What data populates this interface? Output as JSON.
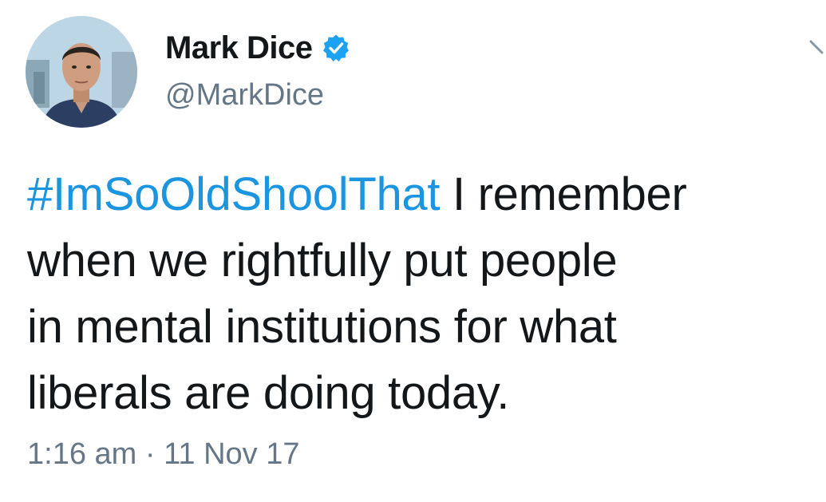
{
  "user": {
    "display_name": "Mark Dice",
    "handle": "@MarkDice",
    "verified_icon": "verified-badge-icon",
    "avatar_icon": "profile-photo"
  },
  "tweet": {
    "hashtag": "#ImSoOldShoolThat",
    "line1_rest": " I remember",
    "line2": "when we rightfully put people",
    "line3": "in mental institutions for what",
    "line4": "liberals are doing today."
  },
  "meta": {
    "time": "1:16 am",
    "separator": " · ",
    "date": "11 Nov 17"
  },
  "icons": {
    "more": "chevron-down-icon"
  },
  "colors": {
    "link_blue": "#1b95e0",
    "text_dark": "#14171a",
    "text_gray": "#657786",
    "verified_blue": "#1da1f2"
  }
}
